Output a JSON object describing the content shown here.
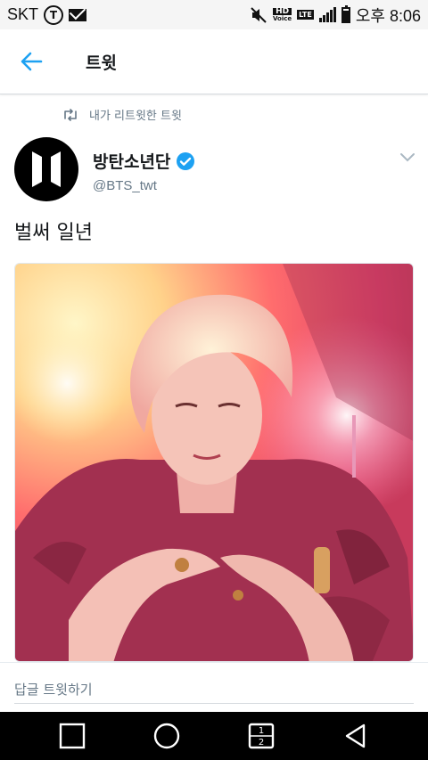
{
  "status_bar": {
    "carrier": "SKT",
    "hd_label": "HD",
    "voice_label": "Voice",
    "lte_label": "LTE",
    "time": "오후 8:06",
    "battery_level": 0.85,
    "icons": [
      "t-logo-icon",
      "mail-icon",
      "mute-icon",
      "hd-voice-icon",
      "lte-icon",
      "signal-icon",
      "battery-icon"
    ]
  },
  "header": {
    "title": "트윗",
    "back_icon": "arrow-left-icon",
    "accent_color": "#1da1f2"
  },
  "tweet": {
    "retweet_context": "내가 리트윗한 트윗",
    "author_name": "방탄소년단",
    "author_handle": "@BTS_twt",
    "verified": true,
    "text": "벌써 일년"
  },
  "reply_bar": {
    "placeholder": "답글 트윗하기"
  },
  "nav_bar": {
    "buttons": [
      "recent-apps-icon",
      "home-icon",
      "dual-window-icon",
      "back-icon"
    ],
    "dual_window_top": "1",
    "dual_window_bottom": "2"
  }
}
